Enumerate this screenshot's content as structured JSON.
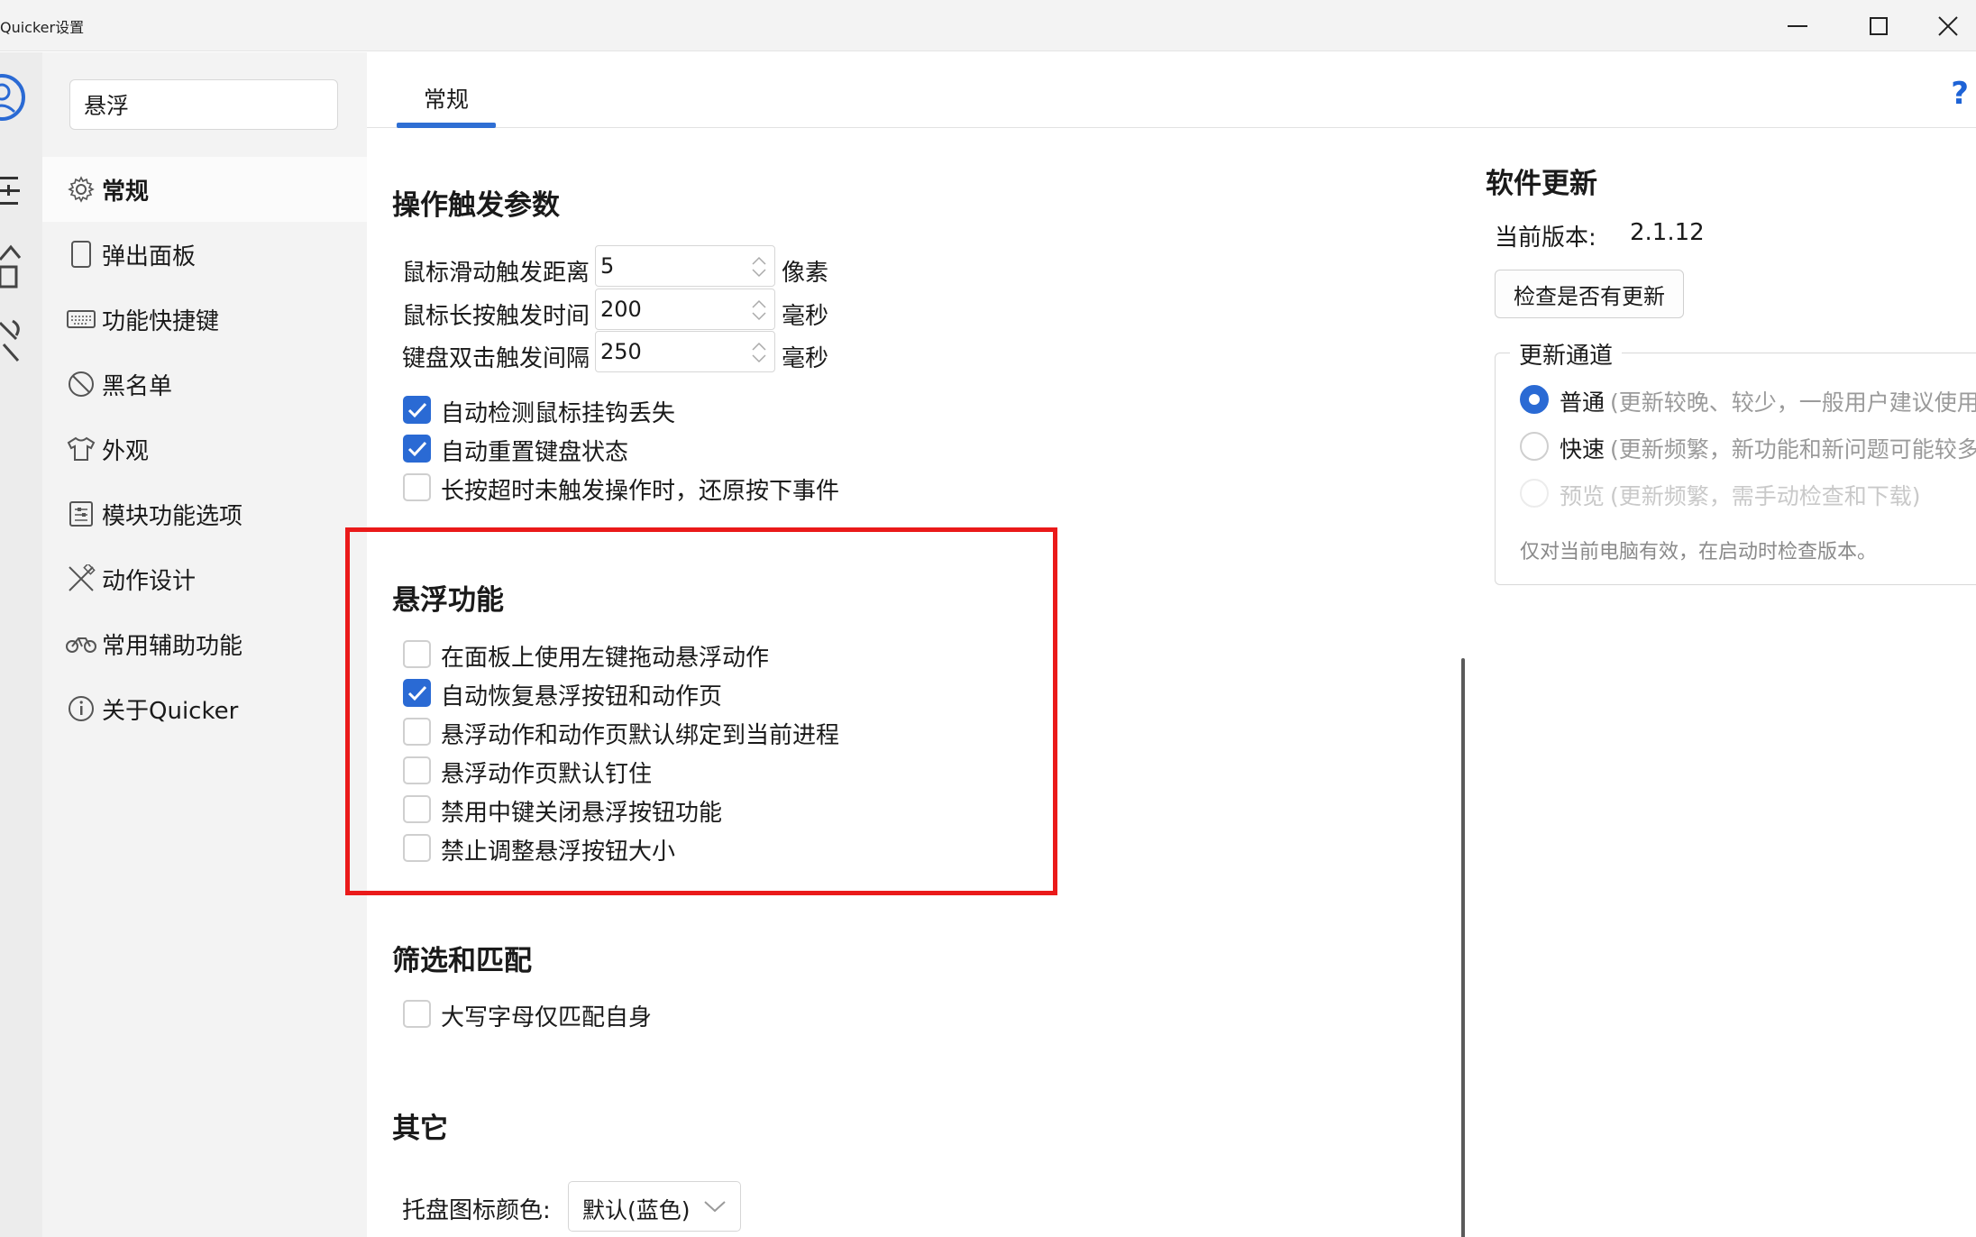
{
  "window": {
    "title": "Quicker设置"
  },
  "nav": {
    "search_value": "悬浮",
    "items": [
      {
        "label": "常规",
        "icon": "gear-icon"
      },
      {
        "label": "弹出面板",
        "icon": "panel-icon"
      },
      {
        "label": "功能快捷键",
        "icon": "keyboard-icon"
      },
      {
        "label": "黑名单",
        "icon": "forbidden-icon"
      },
      {
        "label": "外观",
        "icon": "shirt-icon"
      },
      {
        "label": "模块功能选项",
        "icon": "sliders-icon"
      },
      {
        "label": "动作设计",
        "icon": "design-tools-icon"
      },
      {
        "label": "常用辅助功能",
        "icon": "bicycle-icon"
      },
      {
        "label": "关于Quicker",
        "icon": "info-icon"
      }
    ]
  },
  "main": {
    "tab_label": "常规",
    "help_label": "?",
    "trigger": {
      "title": "操作触发参数",
      "params": [
        {
          "label": "鼠标滑动触发距离",
          "value": "5",
          "unit": "像素"
        },
        {
          "label": "鼠标长按触发时间",
          "value": "200",
          "unit": "毫秒"
        },
        {
          "label": "键盘双击触发间隔",
          "value": "250",
          "unit": "毫秒"
        }
      ],
      "options": [
        {
          "label": "自动检测鼠标挂钩丢失",
          "checked": true
        },
        {
          "label": "自动重置键盘状态",
          "checked": true
        },
        {
          "label": "长按超时未触发操作时，还原按下事件",
          "checked": false
        }
      ]
    },
    "floating": {
      "title": "悬浮功能",
      "options": [
        {
          "label": "在面板上使用左键拖动悬浮动作",
          "checked": false
        },
        {
          "label": "自动恢复悬浮按钮和动作页",
          "checked": true
        },
        {
          "label": "悬浮动作和动作页默认绑定到当前进程",
          "checked": false
        },
        {
          "label": "悬浮动作页默认钉住",
          "checked": false
        },
        {
          "label": "禁用中键关闭悬浮按钮功能",
          "checked": false
        },
        {
          "label": "禁止调整悬浮按钮大小",
          "checked": false
        }
      ]
    },
    "filter": {
      "title": "筛选和匹配",
      "options": [
        {
          "label": "大写字母仅匹配自身",
          "checked": false
        }
      ]
    },
    "other": {
      "title": "其它",
      "tray_label": "托盘图标颜色:",
      "tray_value": "默认(蓝色)"
    }
  },
  "update": {
    "title": "软件更新",
    "version_label": "当前版本:",
    "version_value": "2.1.12",
    "check_button": "检查是否有更新",
    "channel_legend": "更新通道",
    "channels": [
      {
        "name": "普通",
        "desc": "(更新较晚、较少，一般用户建议使用",
        "selected": true,
        "disabled": false
      },
      {
        "name": "快速",
        "desc": "(更新频繁，新功能和新问题可能较多)",
        "selected": false,
        "disabled": false
      },
      {
        "name": "预览",
        "desc": "(更新频繁，需手动检查和下载)",
        "selected": false,
        "disabled": true
      }
    ],
    "note": "仅对当前电脑有效，在启动时检查版本。"
  },
  "colors": {
    "accent": "#2a6ad4",
    "highlight_box": "#ea1a1a"
  }
}
